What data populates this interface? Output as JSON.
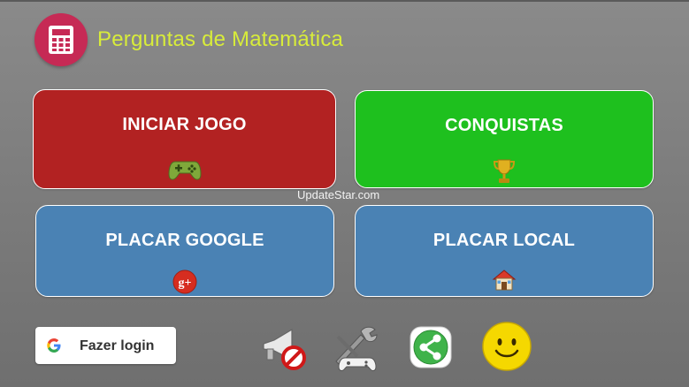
{
  "header": {
    "title": "Perguntas de Matemática",
    "icon": "calculator-icon"
  },
  "tiles": {
    "start": {
      "label": "INICIAR JOGO",
      "icon": "gamepad-icon",
      "color": "#b22222"
    },
    "achievements": {
      "label": "CONQUISTAS",
      "icon": "trophy-icon",
      "color": "#1ec01e"
    },
    "google_scores": {
      "label": "PLACAR GOOGLE",
      "icon": "google-plus-icon",
      "color": "#4a82b4"
    },
    "local_scores": {
      "label": "PLACAR LOCAL",
      "icon": "house-icon",
      "color": "#4a82b4"
    }
  },
  "watermark": "UpdateStar.com",
  "login": {
    "label": "Fazer login",
    "icon": "google-g-icon"
  },
  "bottom_icons": [
    "sound-off-icon",
    "settings-tools-icon",
    "share-icon",
    "smiley-icon"
  ]
}
